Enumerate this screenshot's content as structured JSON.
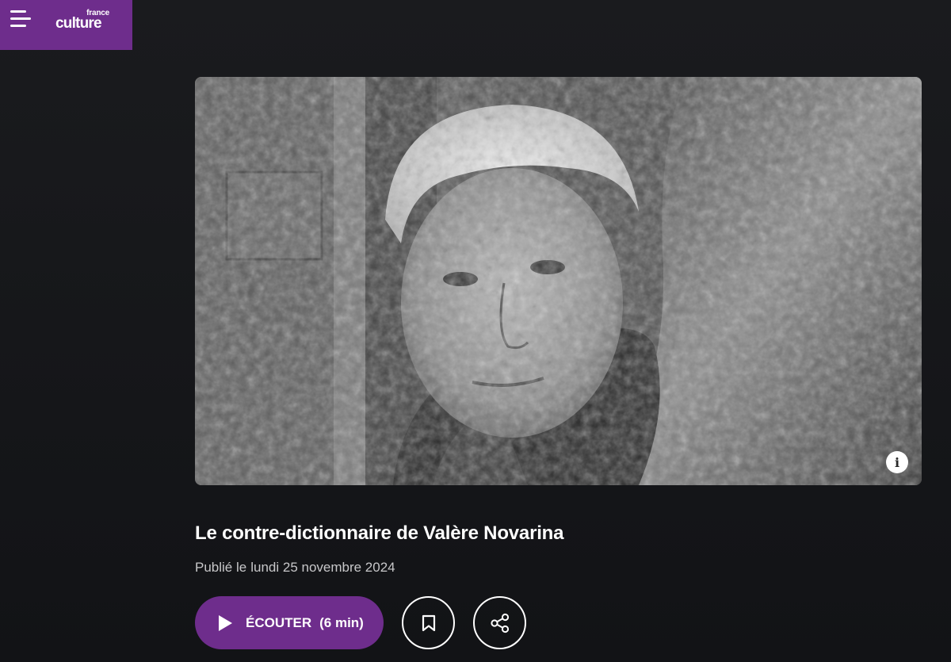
{
  "header": {
    "menu_icon": "hamburger-menu-icon",
    "logo_top": "france",
    "logo_main": "culture",
    "brand_color": "#6e2d8c"
  },
  "hero": {
    "info_label": "i",
    "info_icon": "info-icon"
  },
  "article": {
    "title": "Le contre-dictionnaire de Valère Novarina",
    "published_prefix": "Publié le",
    "published_date": "lundi 25 novembre 2024"
  },
  "actions": {
    "listen_label": "ÉCOUTER",
    "listen_duration": "(6 min)",
    "listen_icon": "play-icon",
    "bookmark_icon": "bookmark-icon",
    "share_icon": "share-icon",
    "accent": "#6e2d8c"
  }
}
